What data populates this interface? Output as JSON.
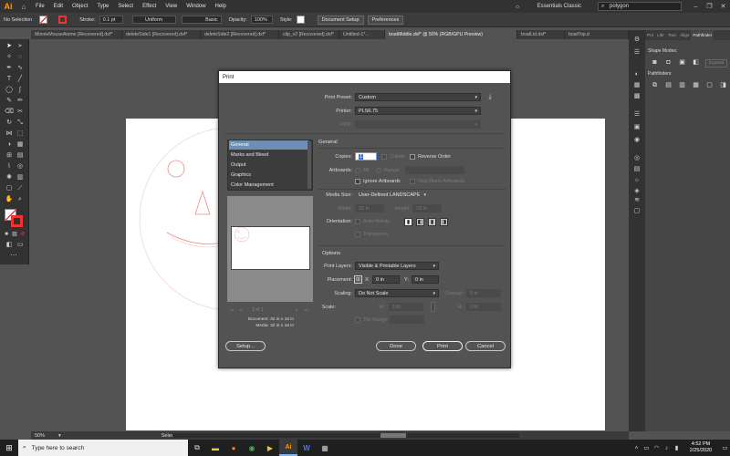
{
  "app": {
    "logo_text": "Ai",
    "menus": [
      "File",
      "Edit",
      "Object",
      "Type",
      "Select",
      "Effect",
      "View",
      "Window",
      "Help"
    ],
    "workspace": "Essentials Classic",
    "search_value": "polygon"
  },
  "control_bar": {
    "selection_label": "No Selection",
    "stroke_label": "Stroke:",
    "stroke_value": "0.1 pt",
    "profile_value": "Uniform",
    "brush_value": "Basic",
    "opacity_label": "Opacity:",
    "opacity_value": "100%",
    "style_label": "Style:",
    "document_setup": "Document Setup",
    "preferences": "Preferences"
  },
  "doc_tabs": [
    "MinnieMouseAnime [Recovered].dxf*",
    "deleteSide1 [Recovered].dxf*",
    "deleteSide2 [Recovered].dxf*",
    "clip_v2 [Recovered].dxf*",
    "Untitled-1*...",
    "boatMiddle.dxf* @ 50% (RGB/GPU Preview)",
    "boatLid.dxf*",
    "boatTop.d"
  ],
  "right_panel": {
    "tabs": [
      "Pro",
      "Libr",
      "Tran",
      "Align",
      "Pathfinder"
    ],
    "shape_modes_label": "Shape Modes:",
    "expand_label": "Expand",
    "pathfinders_label": "Pathfinders:"
  },
  "status_bar": {
    "zoom": "50%",
    "mode": "Selection"
  },
  "taskbar": {
    "search_placeholder": "Type here to search",
    "time": "4:52 PM",
    "date": "2/25/2020"
  },
  "print_dialog": {
    "title": "Print",
    "print_preset_label": "Print Preset:",
    "print_preset_value": "Custom",
    "printer_label": "Printer:",
    "printer_value": "PLS6.75",
    "ppd_label": "PPD:",
    "categories": [
      "General",
      "Marks and Bleed",
      "Output",
      "Graphics",
      "Color Management"
    ],
    "section_general": "General",
    "copies_label": "Copies:",
    "copies_value": "1",
    "collate_label": "Collate",
    "reverse_order_label": "Reverse Order",
    "artboards_label": "Artboards:",
    "all_label": "All",
    "range_label": "Range:",
    "ignore_artboards_label": "Ignore Artboards",
    "skip_blank_label": "Skip Blank Artboards",
    "media_size_label": "Media Size:",
    "media_size_value": "User-Defined LANDSCAPE",
    "width_label": "Width:",
    "width_value": "32 in",
    "height_label": "Height:",
    "height_value": "18 in",
    "orientation_label": "Orientation:",
    "auto_rotate_label": "Auto-Rotate",
    "transverse_label": "Transverse",
    "section_options": "Options",
    "print_layers_label": "Print Layers:",
    "print_layers_value": "Visible & Printable Layers",
    "placement_label": "Placement:",
    "x_label": "X:",
    "x_value": "0 in",
    "y_label": "Y:",
    "y_value": "0 in",
    "scaling_label": "Scaling:",
    "scaling_value": "Do Not Scale",
    "overlap_label": "Overlap:",
    "overlap_value": "0 in",
    "scale_label": "Scale:",
    "scale_w_label": "W:",
    "scale_w_value": "100",
    "scale_h_label": "H:",
    "scale_h_value": "100",
    "tile_range_label": "Tile Range:",
    "page_nav_value": "1 of 1",
    "document_size": "Document: 32 in x 18 in",
    "media_size_info": "Media: 32 in x 18 in",
    "setup_button": "Setup...",
    "done_button": "Done",
    "print_button": "Print",
    "cancel_button": "Cancel"
  }
}
